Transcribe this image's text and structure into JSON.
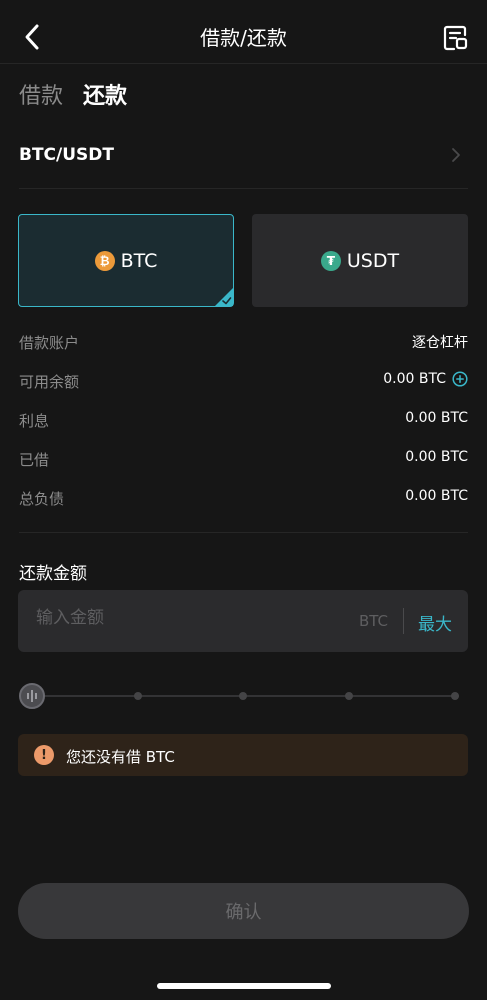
{
  "header": {
    "title": "借款/还款",
    "back_icon": "chevron-left-icon",
    "record_icon": "record-list-icon"
  },
  "tabs": [
    {
      "label": "借款",
      "active": false
    },
    {
      "label": "还款",
      "active": true
    }
  ],
  "pair": {
    "label": "BTC/USDT",
    "icon": "chevron-right-icon"
  },
  "coins": [
    {
      "label": "BTC",
      "icon_glyph": "₿",
      "selected": true
    },
    {
      "label": "USDT",
      "icon_glyph": "₮",
      "selected": false
    }
  ],
  "info": [
    {
      "label": "借款账户",
      "value": "逐仓杠杆"
    },
    {
      "label": "可用余额",
      "value": "0.00 BTC"
    },
    {
      "label": "利息",
      "value": "0.00 BTC"
    },
    {
      "label": "已借",
      "value": "0.00 BTC"
    },
    {
      "label": "总负债",
      "value": "0.00 BTC"
    }
  ],
  "repay": {
    "title": "还款金额",
    "placeholder": "输入金额",
    "value": "",
    "unit": "BTC",
    "max_label": "最大"
  },
  "slider": {
    "value": 0
  },
  "warning": {
    "icon_glyph": "!",
    "text": "您还没有借 BTC"
  },
  "confirm_label": "确认",
  "colors": {
    "accent": "#3ab7c9",
    "background": "#161616",
    "warning": "#ec9a6a",
    "btc": "#ec9a3a",
    "usdt": "#3aa98c"
  }
}
